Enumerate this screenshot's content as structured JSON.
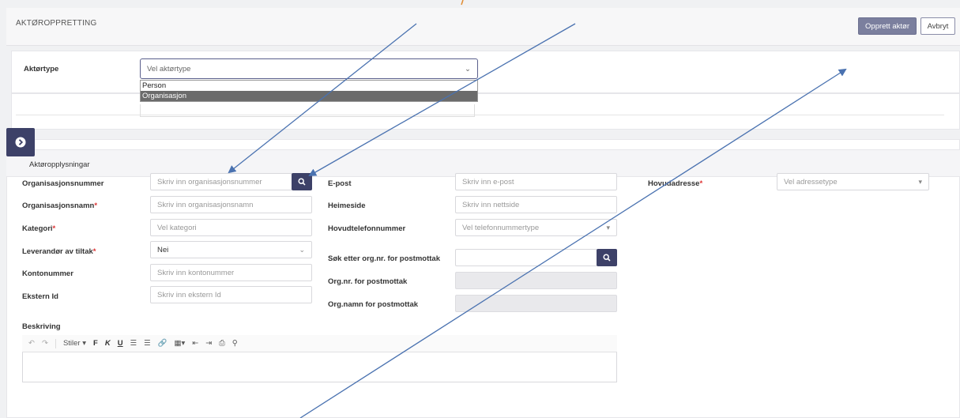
{
  "header": {
    "title": "AKTØROPPRETTING",
    "create_label": "Opprett aktør",
    "cancel_label": "Avbryt"
  },
  "actor_type": {
    "label": "Aktørtype",
    "placeholder": "Vel aktørtype",
    "options": [
      "Person",
      "Organisasjon"
    ],
    "highlighted": "Organisasjon"
  },
  "section": {
    "title": "Aktøropplysningar"
  },
  "form": {
    "org_number": {
      "label": "Organisasjonsnummer",
      "placeholder": "Skriv inn organisasjonsnummer"
    },
    "org_name": {
      "label": "Organisasjonsnamn",
      "required": "*",
      "placeholder": "Skriv inn organisasjonsnamn"
    },
    "category": {
      "label": "Kategori",
      "required": "*",
      "placeholder": "Vel kategori"
    },
    "supplier": {
      "label": "Leverandør av tiltak",
      "required": "*",
      "value": "Nei"
    },
    "account": {
      "label": "Kontonummer",
      "placeholder": "Skriv inn kontonummer"
    },
    "external_id": {
      "label": "Ekstern Id",
      "placeholder": "Skriv inn ekstern Id"
    },
    "email": {
      "label": "E-post",
      "placeholder": "Skriv inn e-post"
    },
    "homepage": {
      "label": "Heimeside",
      "placeholder": "Skriv inn nettside"
    },
    "phone": {
      "label": "Hovudtelefonnummer",
      "placeholder": "Vel telefonnummertype"
    },
    "search_org": {
      "label": "Søk etter org.nr. for postmottak"
    },
    "post_org_nr": {
      "label": "Org.nr. for postmottak"
    },
    "post_org_name": {
      "label": "Org.namn for postmottak"
    },
    "main_address": {
      "label": "Hovudadresse",
      "required": "*",
      "placeholder": "Vel adressetype"
    },
    "description": {
      "label": "Beskriving"
    }
  },
  "editor_toolbar": {
    "styles_label": "Stiler",
    "bold": "F",
    "italic": "K",
    "underline": "U"
  },
  "colors": {
    "accent": "#3d4168",
    "primary_button": "#7b7f9e",
    "annotation": "#4a72b0",
    "required": "#d33333"
  }
}
